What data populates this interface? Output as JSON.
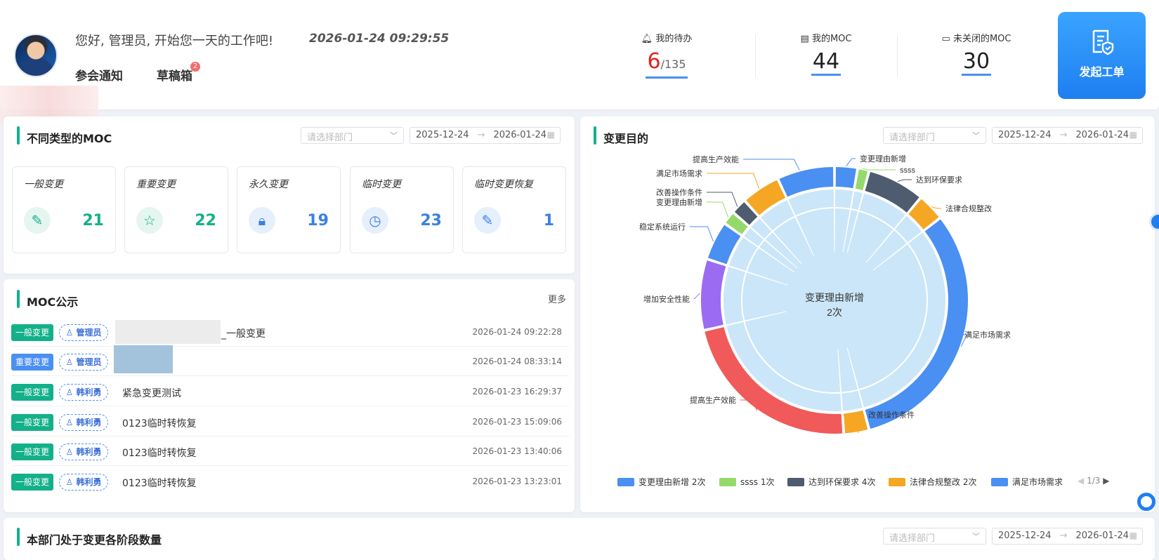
{
  "header": {
    "greeting": "您好, 管理员, 开始您一天的工作吧!",
    "datetime": "2026-01-24 09:29:55",
    "links": {
      "meeting": "参会通知",
      "drafts": "草稿箱",
      "drafts_badge": "2"
    },
    "stats": {
      "todo": {
        "label": "我的待办",
        "value": "6",
        "total": "/135"
      },
      "my_moc": {
        "label": "我的MOC",
        "value": "44"
      },
      "open_moc": {
        "label": "未关闭的MOC",
        "value": "30"
      }
    },
    "launch_button": "发起工单"
  },
  "moc_types": {
    "title": "不同类型的MOC",
    "dept_placeholder": "请选择部门",
    "date_start": "2025-12-24",
    "date_end": "2026-01-24",
    "cards": [
      {
        "name": "一般变更",
        "count": "21",
        "icon": "edit-icon"
      },
      {
        "name": "重要变更",
        "count": "22",
        "icon": "star-icon"
      },
      {
        "name": "永久变更",
        "count": "19",
        "icon": "lock-icon"
      },
      {
        "name": "临时变更",
        "count": "23",
        "icon": "clock-icon"
      },
      {
        "name": "临时变更恢复",
        "count": "1",
        "icon": "edit-icon"
      }
    ]
  },
  "notice": {
    "title": "MOC公示",
    "more": "更多",
    "rows": [
      {
        "type": "一般变更",
        "user": "管理员",
        "title": "_一般变更",
        "time": "2026-01-24 09:22:28"
      },
      {
        "type": "重要变更",
        "user": "管理员",
        "title": "",
        "time": "2026-01-24 08:33:14"
      },
      {
        "type": "一般变更",
        "user": "韩利勇",
        "title": "紧急变更测试",
        "time": "2026-01-23 16:29:37"
      },
      {
        "type": "一般变更",
        "user": "韩利勇",
        "title": "0123临时转恢复",
        "time": "2026-01-23 15:09:06"
      },
      {
        "type": "一般变更",
        "user": "韩利勇",
        "title": "0123临时转恢复",
        "time": "2026-01-23 13:40:06"
      },
      {
        "type": "一般变更",
        "user": "韩利勇",
        "title": "0123临时转恢复",
        "time": "2026-01-23 13:23:01"
      }
    ]
  },
  "purpose": {
    "title": "变更目的",
    "dept_placeholder": "请选择部门",
    "date_start": "2025-12-24",
    "date_end": "2026-01-24",
    "center_label": "变更理由新增",
    "center_value": "2次",
    "pager": "1/3",
    "colors": {
      "blue": "#4a8ff2",
      "green": "#95d96b",
      "slate": "#4f5b6e",
      "orange": "#f5a623",
      "purple": "#9b6cf2",
      "red": "#f05a5a"
    }
  },
  "chart_data": {
    "type": "pie",
    "center": {
      "label": "变更理由新增",
      "value": "2次"
    },
    "slice_labels": [
      "变更理由新增",
      "ssss",
      "达到环保要求",
      "法律合规整改",
      "满足市场需求",
      "改善操作条件",
      "提高生产效能",
      "增加安全性能",
      "稳定系统运行",
      "变更理由新增",
      "改善操作条件",
      "满足市场需求",
      "提高生产效能"
    ],
    "legend": [
      {
        "name": "变更理由新增",
        "value": "2次"
      },
      {
        "name": "ssss",
        "value": "1次"
      },
      {
        "name": "达到环保要求",
        "value": "4次"
      },
      {
        "name": "法律合规整改",
        "value": "2次"
      },
      {
        "name": "满足市场需求",
        "value": ""
      }
    ]
  },
  "stage": {
    "title": "本部门处于变更各阶段数量",
    "dept_placeholder": "请选择部门",
    "date_start": "2025-12-24",
    "date_end": "2026-01-24"
  }
}
